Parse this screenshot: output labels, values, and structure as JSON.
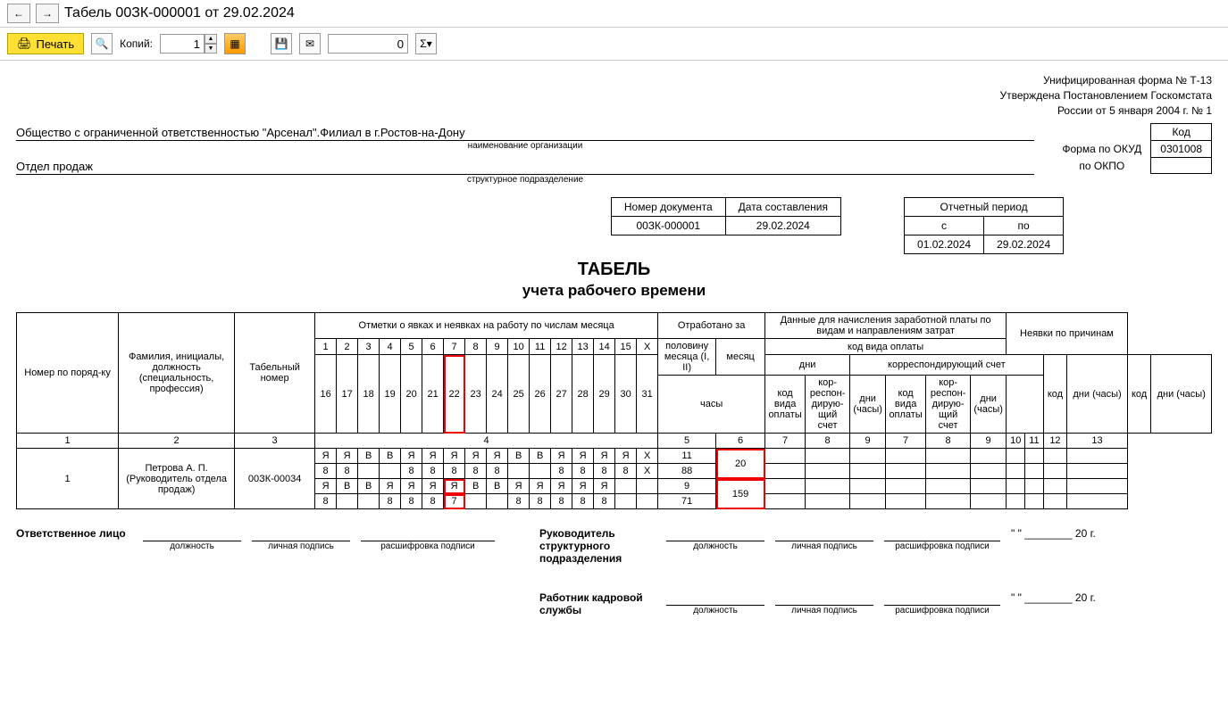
{
  "app": {
    "title": "Табель 00ЗК-000001 от 29.02.2024"
  },
  "toolbar": {
    "print": "Печать",
    "copies_label": "Копий:",
    "copies_value": "1",
    "number_value": "0"
  },
  "form_meta": {
    "line1": "Унифицированная форма № Т-13",
    "line2": "Утверждена Постановлением Госкомстата",
    "line3": "России от 5 января 2004 г. № 1"
  },
  "codes": {
    "kod_label": "Код",
    "okud_label": "Форма по ОКУД",
    "okud_value": "0301008",
    "okpo_label": "по ОКПО",
    "okpo_value": ""
  },
  "org": {
    "name": "Общество с ограниченной ответственностью \"Арсенал\".Филиал в г.Ростов-на-Дону",
    "name_cap": "наименование организации",
    "unit": "Отдел продаж",
    "unit_cap": "структурное подразделение"
  },
  "docnum": {
    "num_label": "Номер документа",
    "num_value": "00ЗК-000001",
    "date_label": "Дата составления",
    "date_value": "29.02.2024"
  },
  "period": {
    "title": "Отчетный период",
    "from_label": "с",
    "to_label": "по",
    "from": "01.02.2024",
    "to": "29.02.2024"
  },
  "titles": {
    "main": "ТАБЕЛЬ",
    "sub": "учета  рабочего времени"
  },
  "head": {
    "c1": "Номер по поряд-ку",
    "c2": "Фамилия, инициалы, должность (специальность, профессия)",
    "c3": "Табельный номер",
    "c4": "Отметки о явках и неявках на работу по числам месяца",
    "c5_group": "Отработано за",
    "c5a": "половину месяца (I, II)",
    "c5b": "месяц",
    "c5_days": "дни",
    "c5_hours": "часы",
    "c6_group": "Данные для начисления заработной платы по видам и направлениям затрат",
    "c6_sub1": "код вида оплаты",
    "c6_sub2": "корреспондирующий счет",
    "c7": "код вида оплаты",
    "c8": "кор-респон-дирую-щий счет",
    "c9": "дни (часы)",
    "c_absence": "Неявки по причинам",
    "c_code": "код",
    "c_dh": "дни (часы)",
    "days1": [
      "1",
      "2",
      "3",
      "4",
      "5",
      "6",
      "7",
      "8",
      "9",
      "10",
      "11",
      "12",
      "13",
      "14",
      "15",
      "X"
    ],
    "days2": [
      "16",
      "17",
      "18",
      "19",
      "20",
      "21",
      "22",
      "23",
      "24",
      "25",
      "26",
      "27",
      "28",
      "29",
      "30",
      "31"
    ],
    "colnums": [
      "1",
      "2",
      "3",
      "4",
      "5",
      "6",
      "7",
      "8",
      "9",
      "7",
      "8",
      "9",
      "10",
      "11",
      "12",
      "13"
    ]
  },
  "row": {
    "num": "1",
    "name": "Петрова А. П. (Руководитель отдела продаж)",
    "tab_num": "00ЗК-00034",
    "marks1": [
      "Я",
      "Я",
      "В",
      "В",
      "Я",
      "Я",
      "Я",
      "Я",
      "Я",
      "В",
      "В",
      "Я",
      "Я",
      "Я",
      "Я",
      "X"
    ],
    "hours1": [
      "8",
      "8",
      "",
      "",
      "8",
      "8",
      "8",
      "8",
      "8",
      "",
      "",
      "8",
      "8",
      "8",
      "8",
      "X"
    ],
    "marks2": [
      "Я",
      "В",
      "В",
      "Я",
      "Я",
      "Я",
      "Я",
      "В",
      "В",
      "Я",
      "Я",
      "Я",
      "Я",
      "Я",
      "",
      ""
    ],
    "hours2": [
      "8",
      "",
      "",
      "8",
      "8",
      "8",
      "7",
      "",
      "",
      "8",
      "8",
      "8",
      "8",
      "8",
      "",
      ""
    ],
    "half_days1": "11",
    "half_hours1": "88",
    "half_days2": "9",
    "half_hours2": "71",
    "month_days": "20",
    "month_hours": "159"
  },
  "sign": {
    "resp_label": "Ответственное лицо",
    "mgr_label": "Руководитель структурного подразделения",
    "hr_label": "Работник кадровой службы",
    "post": "должность",
    "psign": "личная подпись",
    "decode": "расшифровка подписи",
    "date_tpl": "\" \" ________ 20   г."
  }
}
